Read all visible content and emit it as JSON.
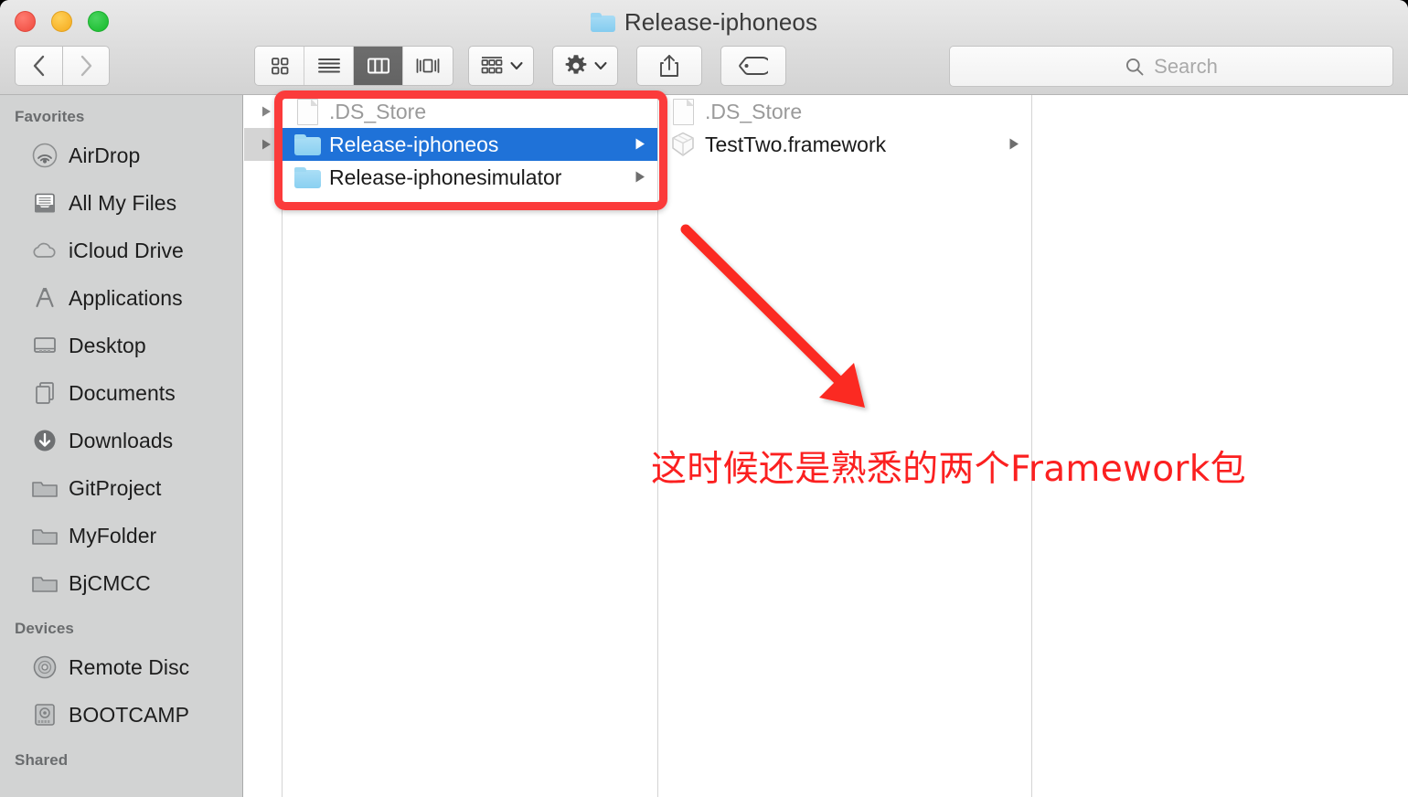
{
  "window": {
    "title": "Release-iphoneos",
    "title_icon": "folder-icon",
    "traffic_lights": {
      "close": "close-button",
      "minimize": "minimize-button",
      "maximize": "maximize-button"
    },
    "colors": {
      "accent_selection": "#1f72d8",
      "annotation_red": "#fb3b3b",
      "sidebar_bg": "#d2d3d3",
      "titlebar_bg": "#dcdcdc",
      "folder_blue": "#8ad0f1"
    }
  },
  "toolbar": {
    "back_label": "Back",
    "forward_label": "Forward",
    "view_modes": [
      {
        "name": "icon-view",
        "icon": "grid-icon",
        "active": false
      },
      {
        "name": "list-view",
        "icon": "list-icon",
        "active": false
      },
      {
        "name": "column-view",
        "icon": "columns-icon",
        "active": true
      },
      {
        "name": "gallery-view",
        "icon": "coverflow-icon",
        "active": false
      }
    ],
    "arrange_label": "Arrange",
    "arrange_icon": "arrange-grid-icon",
    "action_label": "Action",
    "action_icon": "gear-icon",
    "share_label": "Share",
    "share_icon": "share-icon",
    "tags_label": "Tags",
    "tags_icon": "tag-icon"
  },
  "search": {
    "placeholder": "Search",
    "value": "",
    "icon": "search-icon"
  },
  "sidebar": {
    "sections": [
      {
        "header": "Favorites",
        "items": [
          {
            "label": "AirDrop",
            "icon": "airdrop-icon"
          },
          {
            "label": "All My Files",
            "icon": "all-my-files-icon"
          },
          {
            "label": "iCloud Drive",
            "icon": "icloud-icon"
          },
          {
            "label": "Applications",
            "icon": "applications-icon"
          },
          {
            "label": "Desktop",
            "icon": "desktop-icon"
          },
          {
            "label": "Documents",
            "icon": "documents-icon"
          },
          {
            "label": "Downloads",
            "icon": "downloads-icon"
          },
          {
            "label": "GitProject",
            "icon": "folder-icon"
          },
          {
            "label": "MyFolder",
            "icon": "folder-icon"
          },
          {
            "label": "BjCMCC",
            "icon": "folder-icon"
          }
        ]
      },
      {
        "header": "Devices",
        "items": [
          {
            "label": "Remote Disc",
            "icon": "optical-disc-icon"
          },
          {
            "label": "BOOTCAMP",
            "icon": "hard-drive-icon"
          }
        ]
      },
      {
        "header": "Shared",
        "items": []
      }
    ]
  },
  "browser": {
    "columns": [
      {
        "name": "column-0-partial",
        "rows": [
          {
            "label": "",
            "icon": "",
            "dim": false,
            "selected": "none",
            "has_disclosure": true
          },
          {
            "label": "",
            "icon": "",
            "dim": false,
            "selected": "inactive",
            "has_disclosure": true
          }
        ]
      },
      {
        "name": "column-1",
        "rows": [
          {
            "label": ".DS_Store",
            "icon": "document-icon",
            "dim": true,
            "selected": "none",
            "has_disclosure": false
          },
          {
            "label": "Release-iphoneos",
            "icon": "folder-icon",
            "dim": false,
            "selected": "active",
            "has_disclosure": true
          },
          {
            "label": "Release-iphonesimulator",
            "icon": "folder-icon",
            "dim": false,
            "selected": "none",
            "has_disclosure": true
          }
        ]
      },
      {
        "name": "column-2",
        "rows": [
          {
            "label": ".DS_Store",
            "icon": "document-icon",
            "dim": true,
            "selected": "none",
            "has_disclosure": false
          },
          {
            "label": "TestTwo.framework",
            "icon": "framework-icon",
            "dim": false,
            "selected": "none",
            "has_disclosure": true
          }
        ]
      },
      {
        "name": "column-3",
        "rows": []
      }
    ]
  },
  "annotations": {
    "highlight_box": {
      "name": "red-highlight-box",
      "targets": [
        ".DS_Store",
        "Release-iphoneos",
        "Release-iphonesimulator"
      ]
    },
    "arrow": {
      "name": "red-arrow",
      "direction": "down-right"
    },
    "caption": "这时候还是熟悉的两个Framework包"
  }
}
